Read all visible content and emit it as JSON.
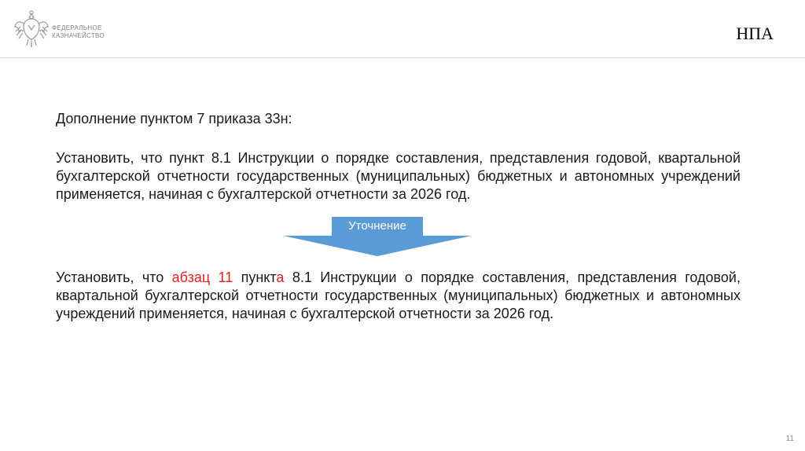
{
  "header": {
    "org_name_line1": "ФЕДЕРАЛЬНОЕ",
    "org_name_line2": "КАЗНАЧЕЙСТВО",
    "section_title": "НПА"
  },
  "content": {
    "intro": "Дополнение пунктом 7 приказа 33н:",
    "original_paragraph": "Установить, что пункт 8.1 Инструкции о порядке составления, представления годовой, квартальной бухгалтерской отчетности государственных (муниципальных) бюджетных и автономных учреждений применяется, начиная с бухгалтерской отчетности за 2026 год.",
    "arrow_label": "Уточнение",
    "revised": {
      "part1": "Установить, что ",
      "highlight1": "абзац 11",
      "part2": " пункт",
      "highlight2": "а",
      "part3": " 8.1 Инструкции о порядке составления, представления годовой, квартальной бухгалтерской отчетности государственных (муниципальных) бюджетных и автономных учреждений применяется, начиная с бухгалтерской отчетности за 2026 год."
    }
  },
  "footer": {
    "page_number": "11"
  },
  "colors": {
    "accent_blue": "#5b9bd5",
    "highlight_red": "#e0231f"
  },
  "icons": {
    "logo": "treasury-eagle-emblem-icon"
  }
}
